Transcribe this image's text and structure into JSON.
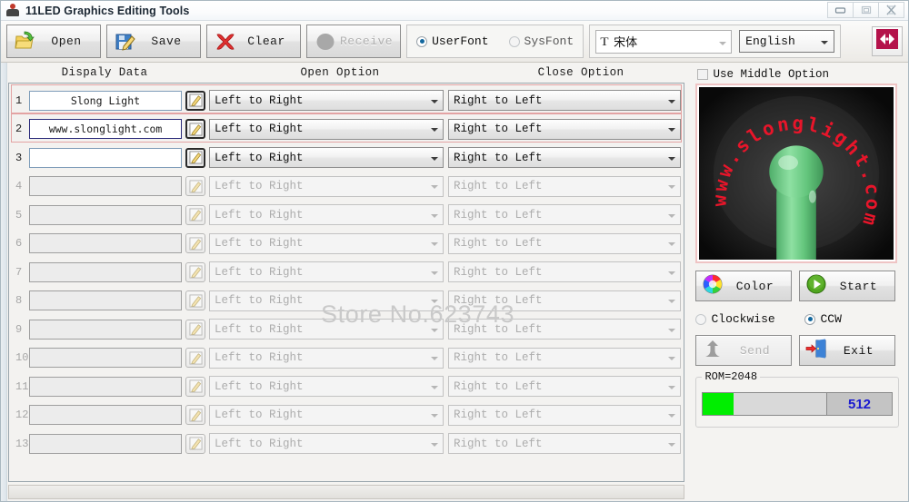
{
  "window": {
    "title": "11LED Graphics Editing Tools",
    "title_watermark": "",
    "minimize_label": "",
    "maximize_label": "",
    "close_label": ""
  },
  "toolbar": {
    "open_label": "Open",
    "save_label": "Save",
    "clear_label": "Clear",
    "receive_label": "Receive",
    "userfont_label": "UserFont",
    "sysfont_label": "SysFont",
    "font_glyph": "T",
    "font_name": "宋体",
    "language": "English",
    "connect_label": ""
  },
  "headers": {
    "display_data": "Dispaly Data",
    "open_option": "Open Option",
    "close_option": "Close Option"
  },
  "watermark": "Store No.623743",
  "rows": [
    {
      "num": "1",
      "text": "Slong Light",
      "open": "Left to Right",
      "close": "Right to Left",
      "enabled": true,
      "highlight": true
    },
    {
      "num": "2",
      "text": "www.slonglight.com",
      "open": "Left to Right",
      "close": "Right to Left",
      "enabled": true,
      "highlight": true
    },
    {
      "num": "3",
      "text": "",
      "open": "Left to Right",
      "close": "Right to Left",
      "enabled": true,
      "highlight": false
    },
    {
      "num": "4",
      "text": "",
      "open": "Left to Right",
      "close": "Right to Left",
      "enabled": false,
      "highlight": false
    },
    {
      "num": "5",
      "text": "",
      "open": "Left to Right",
      "close": "Right to Left",
      "enabled": false,
      "highlight": false
    },
    {
      "num": "6",
      "text": "",
      "open": "Left to Right",
      "close": "Right to Left",
      "enabled": false,
      "highlight": false
    },
    {
      "num": "7",
      "text": "",
      "open": "Left to Right",
      "close": "Right to Left",
      "enabled": false,
      "highlight": false
    },
    {
      "num": "8",
      "text": "",
      "open": "Left to Right",
      "close": "Right to Left",
      "enabled": false,
      "highlight": false
    },
    {
      "num": "9",
      "text": "",
      "open": "Left to Right",
      "close": "Right to Left",
      "enabled": false,
      "highlight": false
    },
    {
      "num": "10",
      "text": "",
      "open": "Left to Right",
      "close": "Right to Left",
      "enabled": false,
      "highlight": false
    },
    {
      "num": "11",
      "text": "",
      "open": "Left to Right",
      "close": "Right to Left",
      "enabled": false,
      "highlight": false
    },
    {
      "num": "12",
      "text": "",
      "open": "Left to Right",
      "close": "Right to Left",
      "enabled": false,
      "highlight": false
    },
    {
      "num": "13",
      "text": "",
      "open": "Left to Right",
      "close": "Right to Left",
      "enabled": false,
      "highlight": false
    }
  ],
  "right": {
    "use_middle_option_label": "Use Middle Option",
    "use_middle_option_checked": false,
    "preview_text": "www.slonglight.com",
    "preview_text_color": "#e8152a",
    "preview_fan_color": "#72d18a",
    "color_label": "Color",
    "start_label": "Start",
    "clockwise_label": "Clockwise",
    "ccw_label": "CCW",
    "rotation_selected": "CCW",
    "send_label": "Send",
    "exit_label": "Exit",
    "rom_label": "ROM=2048",
    "rom_value": "512",
    "rom_percent": 25
  },
  "colors": {
    "accent_red": "#b4124a",
    "progress_green": "#00ee00",
    "value_blue": "#1a1ad0",
    "highlight_border": "#e3a3a3"
  }
}
